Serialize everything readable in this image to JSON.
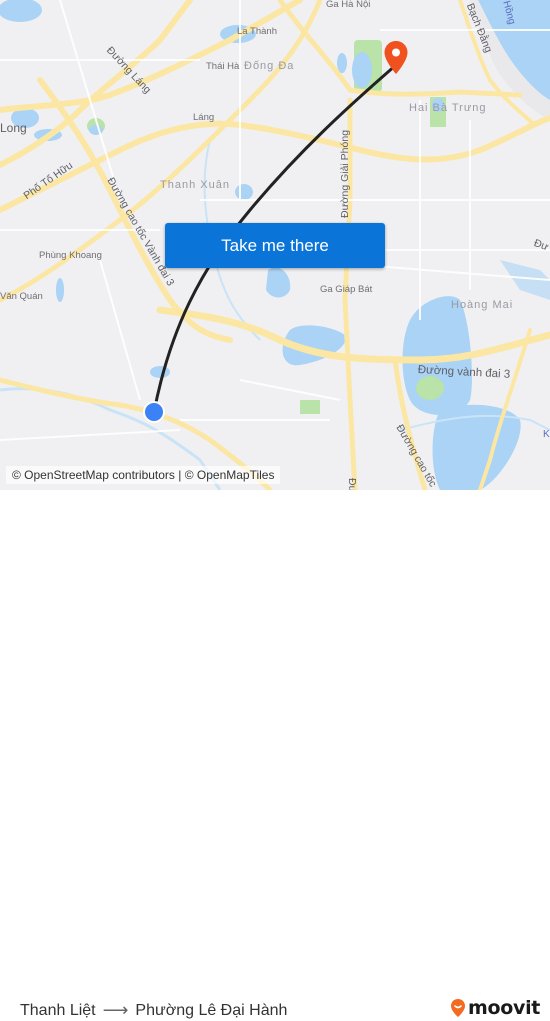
{
  "map": {
    "labels": {
      "ga_ha_noi": "Ga Hà Nội",
      "la_thanh": "La Thành",
      "thai_ha": "Thái Hà",
      "dong_da": "Đống Đa",
      "duong_lang": "Đường Láng",
      "lang": "Láng",
      "long": "Long",
      "pho_to_huu": "Phố Tố Hữu",
      "thanh_xuan": "Thanh Xuân",
      "duong_cao_toc_vanh_dai_3": "Đường cao tốc Vành đai 3",
      "phung_khoang": "Phùng Khoang",
      "van_quan": "Văn Quán",
      "duong_giai_phong": "Đường Giải Phóng",
      "hai_ba_trung": "Hai Bà Trưng",
      "bach_dang": "Bạch Đằng",
      "hong": "Hồng",
      "ga_giap_bat": "Ga Giáp Bát",
      "hoang_mai": "Hoàng Mai",
      "duong_vanh_dai_3": "Đường vành đai 3",
      "duong_cao_toc": "Đường cao tốc",
      "du_right": "Đư",
      "du_bottom": "Đư",
      "k_edge": "K"
    },
    "origin_marker": {
      "label": "Thanh Liệt",
      "color": "#3b82f6"
    },
    "destination_marker": {
      "label": "Phường Lê Đại Hành",
      "color": "#f0511f"
    },
    "route_line_color": "#222222"
  },
  "cta": {
    "label": "Take me there",
    "color": "#0a74d8"
  },
  "attribution": "© OpenStreetMap contributors | © OpenMapTiles",
  "footer": {
    "origin": "Thanh Liệt",
    "arrow": "⟶",
    "destination": "Phường Lê Đại Hành",
    "brand": "moovit",
    "brand_color": "#f26b21"
  }
}
